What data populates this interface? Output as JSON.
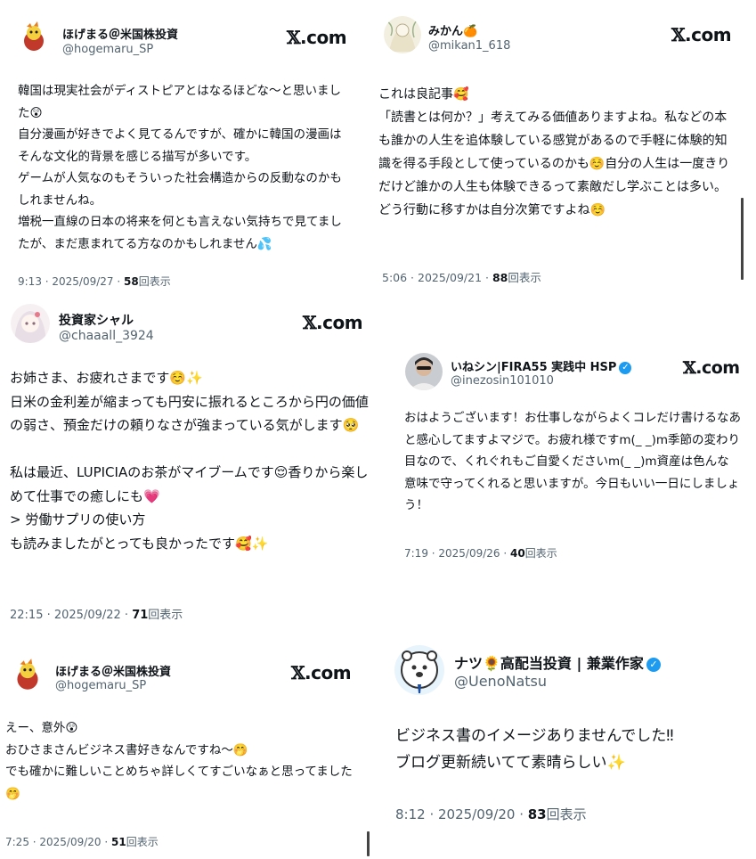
{
  "brand": {
    "site": "X.com"
  },
  "tweets": [
    {
      "name": "ほげまる＠米国株投資",
      "handle": "@hogemaru_SP",
      "text": "韓国は現実社会がディストピアとはなるほどな〜と思いました😲\n自分漫画が好きでよく見てるんですが、確かに韓国の漫画はそんな文化的背景を感じる描写が多いです。\nゲームが人気なのもそういった社会構造からの反動なのかもしれませんね。\n増税一直線の日本の将来を何とも言えない気持ちで見てましたが、まだ恵まれてる方なのかもしれません💦",
      "time": "9:13 · 2025/09/27 · ",
      "views": "58",
      "views_label": "回表示"
    },
    {
      "name": "みかん🍊",
      "handle": "@mikan1_618",
      "text": "これは良記事🥰\n「読書とは何か？」考えてみる価値ありますよね。私などの本も誰かの人生を追体験している感覚があるので手軽に体験的知識を得る手段として使っているのかも☺️自分の人生は一度きりだけど誰かの人生も体験できるって素敵だし学ぶことは多い。どう行動に移すかは自分次第ですよね☺️",
      "time": "5:06 · 2025/09/21 · ",
      "views": "88",
      "views_label": "回表示"
    },
    {
      "name": "投資家シャル",
      "handle": "@chaaall_3924",
      "text": "お姉さま、お疲れさまです☺️✨\n日米の金利差が縮まっても円安に振れるところから円の価値の弱さ、預金だけの頼りなさが強まっている気がします🥺\n\n私は最近、LUPICIAのお茶がマイブームです😌香りから楽しめて仕事での癒しにも💗\n> 労働サプリの使い方\nも読みましたがとっても良かったです🥰✨",
      "time": "22:15 · 2025/09/22 · ",
      "views": "71",
      "views_label": "回表示"
    },
    {
      "name": "いねシン|FIRA55 実践中 HSP",
      "handle": "@inezosin101010",
      "verified": "✓",
      "text": "おはようございます！お仕事しながらよくコレだけ書けるなあと感心してますよマジで。お疲れ様ですm(_ _)m季節の変わり目なので、くれぐれもご自愛くださいm(_ _)m資産は色んな意味で守ってくれると思いますが。今日もいい一日にしましょう！",
      "time": "7:19 · 2025/09/26 · ",
      "views": "40",
      "views_label": "回表示"
    },
    {
      "name": "ほげまる＠米国株投資",
      "handle": "@hogemaru_SP",
      "text": "えー、意外😲\nおひさまさんビジネス書好きなんですね〜🤭\nでも確かに難しいことめちゃ詳しくてすごいなぁと思ってました🤭",
      "time": "7:25 · 2025/09/20 · ",
      "views": "51",
      "views_label": "回表示"
    },
    {
      "name": "ナツ🌻高配当投資 | 兼業作家",
      "handle": "@UenoNatsu",
      "verified": "✓",
      "text": "ビジネス書のイメージありませんでした‼︎\nブログ更新続いてて素晴らしい✨",
      "time": "8:12 · 2025/09/20 · ",
      "views": "83",
      "views_label": "回表示"
    }
  ]
}
